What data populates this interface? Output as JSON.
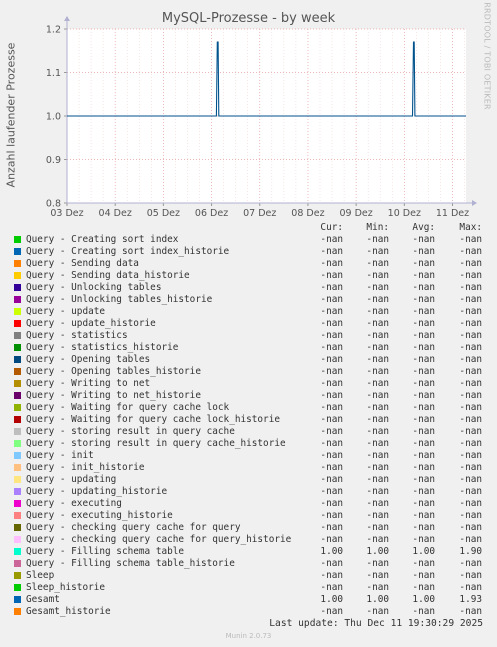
{
  "chart_data": {
    "type": "line",
    "title": "MySQL-Prozesse - by week",
    "ylabel": "Anzahl laufender Prozesse",
    "xlabel": "",
    "ylim": [
      0.8,
      1.2
    ],
    "yticks": [
      "0.8",
      "0.9",
      "1.0",
      "1.1",
      "1.2"
    ],
    "ytick_values": [
      0.8,
      0.9,
      1.0,
      1.1,
      1.2
    ],
    "xticks": [
      "03 Dez",
      "04 Dez",
      "05 Dez",
      "06 Dez",
      "07 Dez",
      "08 Dez",
      "09 Dez",
      "10 Dez",
      "11 Dez"
    ],
    "xlim_days": [
      0,
      8.28
    ],
    "grid": true,
    "series": [
      {
        "name": "Gesamt",
        "color": "#00528d",
        "x_days": [
          0,
          3.1,
          3.12,
          3.135,
          3.15,
          7.17,
          7.19,
          7.205,
          7.22,
          8.28
        ],
        "y": [
          1.0,
          1.0,
          1.17,
          1.17,
          1.0,
          1.0,
          1.17,
          1.17,
          1.0,
          1.0
        ]
      }
    ]
  },
  "side_label": "RRDTOOL / TOBI OETIKER",
  "legend_headers": [
    "Cur:",
    "Min:",
    "Avg:",
    "Max:"
  ],
  "legend": [
    {
      "name": "Query - Creating sort index",
      "color": "#00cc00",
      "cur": "-nan",
      "min": "-nan",
      "avg": "-nan",
      "max": "-nan"
    },
    {
      "name": "Query - Creating sort index_historie",
      "color": "#0066b3",
      "cur": "-nan",
      "min": "-nan",
      "avg": "-nan",
      "max": "-nan"
    },
    {
      "name": "Query - Sending data",
      "color": "#ff8000",
      "cur": "-nan",
      "min": "-nan",
      "avg": "-nan",
      "max": "-nan"
    },
    {
      "name": "Query - Sending data_historie",
      "color": "#ffcc00",
      "cur": "-nan",
      "min": "-nan",
      "avg": "-nan",
      "max": "-nan"
    },
    {
      "name": "Query - Unlocking tables",
      "color": "#330099",
      "cur": "-nan",
      "min": "-nan",
      "avg": "-nan",
      "max": "-nan"
    },
    {
      "name": "Query - Unlocking tables_historie",
      "color": "#990099",
      "cur": "-nan",
      "min": "-nan",
      "avg": "-nan",
      "max": "-nan"
    },
    {
      "name": "Query - update",
      "color": "#ccff00",
      "cur": "-nan",
      "min": "-nan",
      "avg": "-nan",
      "max": "-nan"
    },
    {
      "name": "Query - update_historie",
      "color": "#ff0000",
      "cur": "-nan",
      "min": "-nan",
      "avg": "-nan",
      "max": "-nan"
    },
    {
      "name": "Query - statistics",
      "color": "#808080",
      "cur": "-nan",
      "min": "-nan",
      "avg": "-nan",
      "max": "-nan"
    },
    {
      "name": "Query - statistics_historie",
      "color": "#008f00",
      "cur": "-nan",
      "min": "-nan",
      "avg": "-nan",
      "max": "-nan"
    },
    {
      "name": "Query - Opening tables",
      "color": "#00487d",
      "cur": "-nan",
      "min": "-nan",
      "avg": "-nan",
      "max": "-nan"
    },
    {
      "name": "Query - Opening tables_historie",
      "color": "#b35a00",
      "cur": "-nan",
      "min": "-nan",
      "avg": "-nan",
      "max": "-nan"
    },
    {
      "name": "Query - Writing to net",
      "color": "#b38f00",
      "cur": "-nan",
      "min": "-nan",
      "avg": "-nan",
      "max": "-nan"
    },
    {
      "name": "Query - Writing to net_historie",
      "color": "#6b006b",
      "cur": "-nan",
      "min": "-nan",
      "avg": "-nan",
      "max": "-nan"
    },
    {
      "name": "Query - Waiting for query cache lock",
      "color": "#8fb300",
      "cur": "-nan",
      "min": "-nan",
      "avg": "-nan",
      "max": "-nan"
    },
    {
      "name": "Query - Waiting for query cache lock_historie",
      "color": "#b30000",
      "cur": "-nan",
      "min": "-nan",
      "avg": "-nan",
      "max": "-nan"
    },
    {
      "name": "Query - storing result in query cache",
      "color": "#bebebe",
      "cur": "-nan",
      "min": "-nan",
      "avg": "-nan",
      "max": "-nan"
    },
    {
      "name": "Query - storing result in query cache_historie",
      "color": "#80ff80",
      "cur": "-nan",
      "min": "-nan",
      "avg": "-nan",
      "max": "-nan"
    },
    {
      "name": "Query - init",
      "color": "#80c9ff",
      "cur": "-nan",
      "min": "-nan",
      "avg": "-nan",
      "max": "-nan"
    },
    {
      "name": "Query - init_historie",
      "color": "#ffc080",
      "cur": "-nan",
      "min": "-nan",
      "avg": "-nan",
      "max": "-nan"
    },
    {
      "name": "Query - updating",
      "color": "#ffe680",
      "cur": "-nan",
      "min": "-nan",
      "avg": "-nan",
      "max": "-nan"
    },
    {
      "name": "Query - updating_historie",
      "color": "#aa80ff",
      "cur": "-nan",
      "min": "-nan",
      "avg": "-nan",
      "max": "-nan"
    },
    {
      "name": "Query - executing",
      "color": "#ee00cc",
      "cur": "-nan",
      "min": "-nan",
      "avg": "-nan",
      "max": "-nan"
    },
    {
      "name": "Query - executing_historie",
      "color": "#ff8080",
      "cur": "-nan",
      "min": "-nan",
      "avg": "-nan",
      "max": "-nan"
    },
    {
      "name": "Query - checking query cache for query",
      "color": "#666600",
      "cur": "-nan",
      "min": "-nan",
      "avg": "-nan",
      "max": "-nan"
    },
    {
      "name": "Query - checking query cache for query_historie",
      "color": "#ffbfff",
      "cur": "-nan",
      "min": "-nan",
      "avg": "-nan",
      "max": "-nan"
    },
    {
      "name": "Query - Filling schema table",
      "color": "#00ffcc",
      "cur": "1.00",
      "min": "1.00",
      "avg": "1.00",
      "max": "1.90"
    },
    {
      "name": "Query - Filling schema table_historie",
      "color": "#cc6699",
      "cur": "-nan",
      "min": "-nan",
      "avg": "-nan",
      "max": "-nan"
    },
    {
      "name": "Sleep",
      "color": "#999900",
      "cur": "-nan",
      "min": "-nan",
      "avg": "-nan",
      "max": "-nan"
    },
    {
      "name": "Sleep_historie",
      "color": "#00cc00",
      "cur": "-nan",
      "min": "-nan",
      "avg": "-nan",
      "max": "-nan"
    },
    {
      "name": "Gesamt",
      "color": "#0066b3",
      "cur": "1.00",
      "min": "1.00",
      "avg": "1.00",
      "max": "1.93"
    },
    {
      "name": "Gesamt_historie",
      "color": "#ff8000",
      "cur": "-nan",
      "min": "-nan",
      "avg": "-nan",
      "max": "-nan"
    }
  ],
  "last_update": "Last update: Thu Dec 11 19:30:29 2025",
  "munin_version": "Munin 2.0.73"
}
